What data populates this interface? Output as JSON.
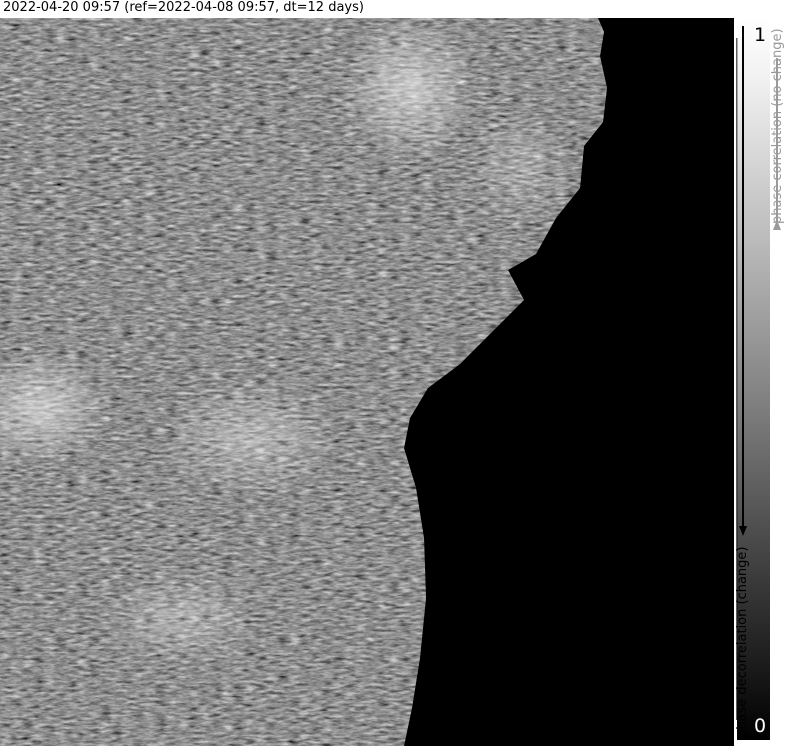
{
  "header": {
    "title": "2022-04-20 09:57 (ref=2022-04-08 09:57, dt=12 days)"
  },
  "image": {
    "description_icon": "sar-coherence-map-image",
    "background": "#000000"
  },
  "colorbar": {
    "max_label": "1",
    "min_label": "0",
    "upper_label": "phase correlation (no change)",
    "lower_label": "phase decorrelation (change)",
    "upper_color": "#9a9a9a",
    "lower_color": "#000000"
  }
}
